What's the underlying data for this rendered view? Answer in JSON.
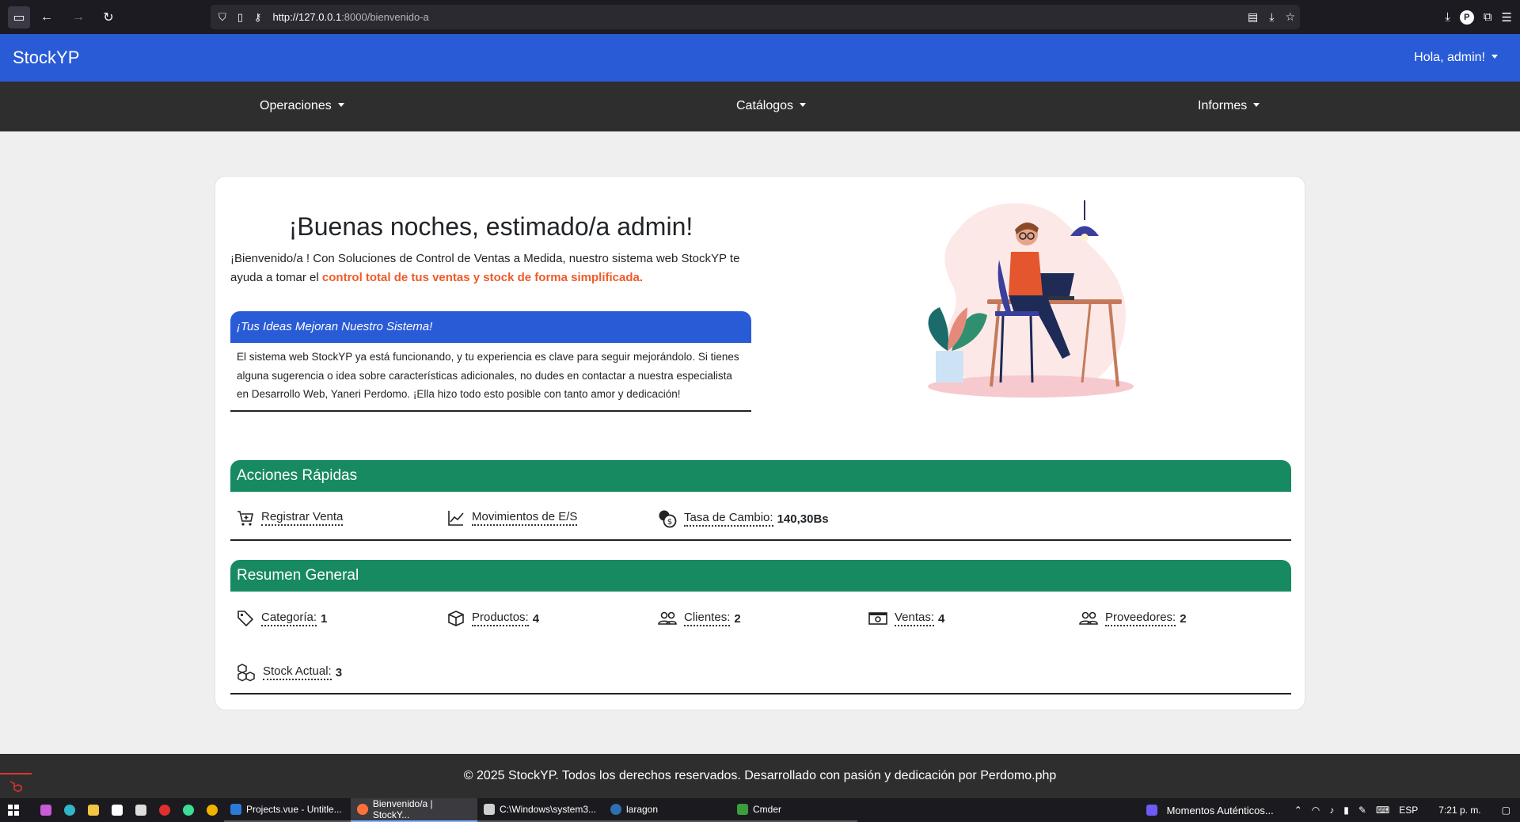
{
  "browser": {
    "url_host": "http://127.0.0.1",
    "url_rest": ":8000/bienvenido-a"
  },
  "navbar": {
    "brand": "StockYP",
    "user_menu": "Hola, admin!"
  },
  "subnav": {
    "items": [
      "Operaciones",
      "Catálogos",
      "Informes"
    ]
  },
  "welcome": {
    "title": "¡Buenas noches, estimado/a admin!",
    "text_before": "¡Bienvenido/a ! Con Soluciones de Control de Ventas a Medida, nuestro sistema web StockYP te ayuda a tomar el ",
    "text_highlight": "control total de tus ventas y stock de forma simplificada."
  },
  "ideas": {
    "heading": "¡Tus Ideas Mejoran Nuestro Sistema!",
    "body": "El sistema web StockYP ya está funcionando, y tu experiencia es clave para seguir mejorándolo. Si tienes alguna sugerencia o idea sobre características adicionales, no dudes en contactar a nuestra especialista en Desarrollo Web, Yaneri Perdomo. ¡Ella hizo todo esto posible con tanto amor y dedicación!"
  },
  "quick_actions": {
    "heading": "Acciones Rápidas",
    "register_sale": "Registrar Venta",
    "movements": "Movimientos de E/S",
    "exchange_label": "Tasa de Cambio:",
    "exchange_value": "140,30Bs"
  },
  "summary": {
    "heading": "Resumen General",
    "categories_label": "Categoría:",
    "categories_value": "1",
    "products_label": "Productos:",
    "products_value": "4",
    "clients_label": "Clientes:",
    "clients_value": "2",
    "sales_label": "Ventas:",
    "sales_value": "4",
    "suppliers_label": "Proveedores:",
    "suppliers_value": "2",
    "stock_label": "Stock Actual:",
    "stock_value": "3"
  },
  "footer": {
    "text": "© 2025 StockYP. Todos los derechos reservados. Desarrollado con pasión y dedicación por Perdomo.php"
  },
  "taskbar": {
    "apps": [
      "Projects.vue - Untitle...",
      "Bienvenido/a | StockY...",
      "C:\\Windows\\system3...",
      "laragon",
      "Cmder"
    ],
    "media": "Momentos Auténticos...",
    "lang": "ESP",
    "time": "7:21 p. m."
  },
  "colors": {
    "brand_blue": "#2a5bd7",
    "section_green": "#188a62",
    "highlight_orange": "#f05a28",
    "dark_nav": "#2e2e2e"
  }
}
